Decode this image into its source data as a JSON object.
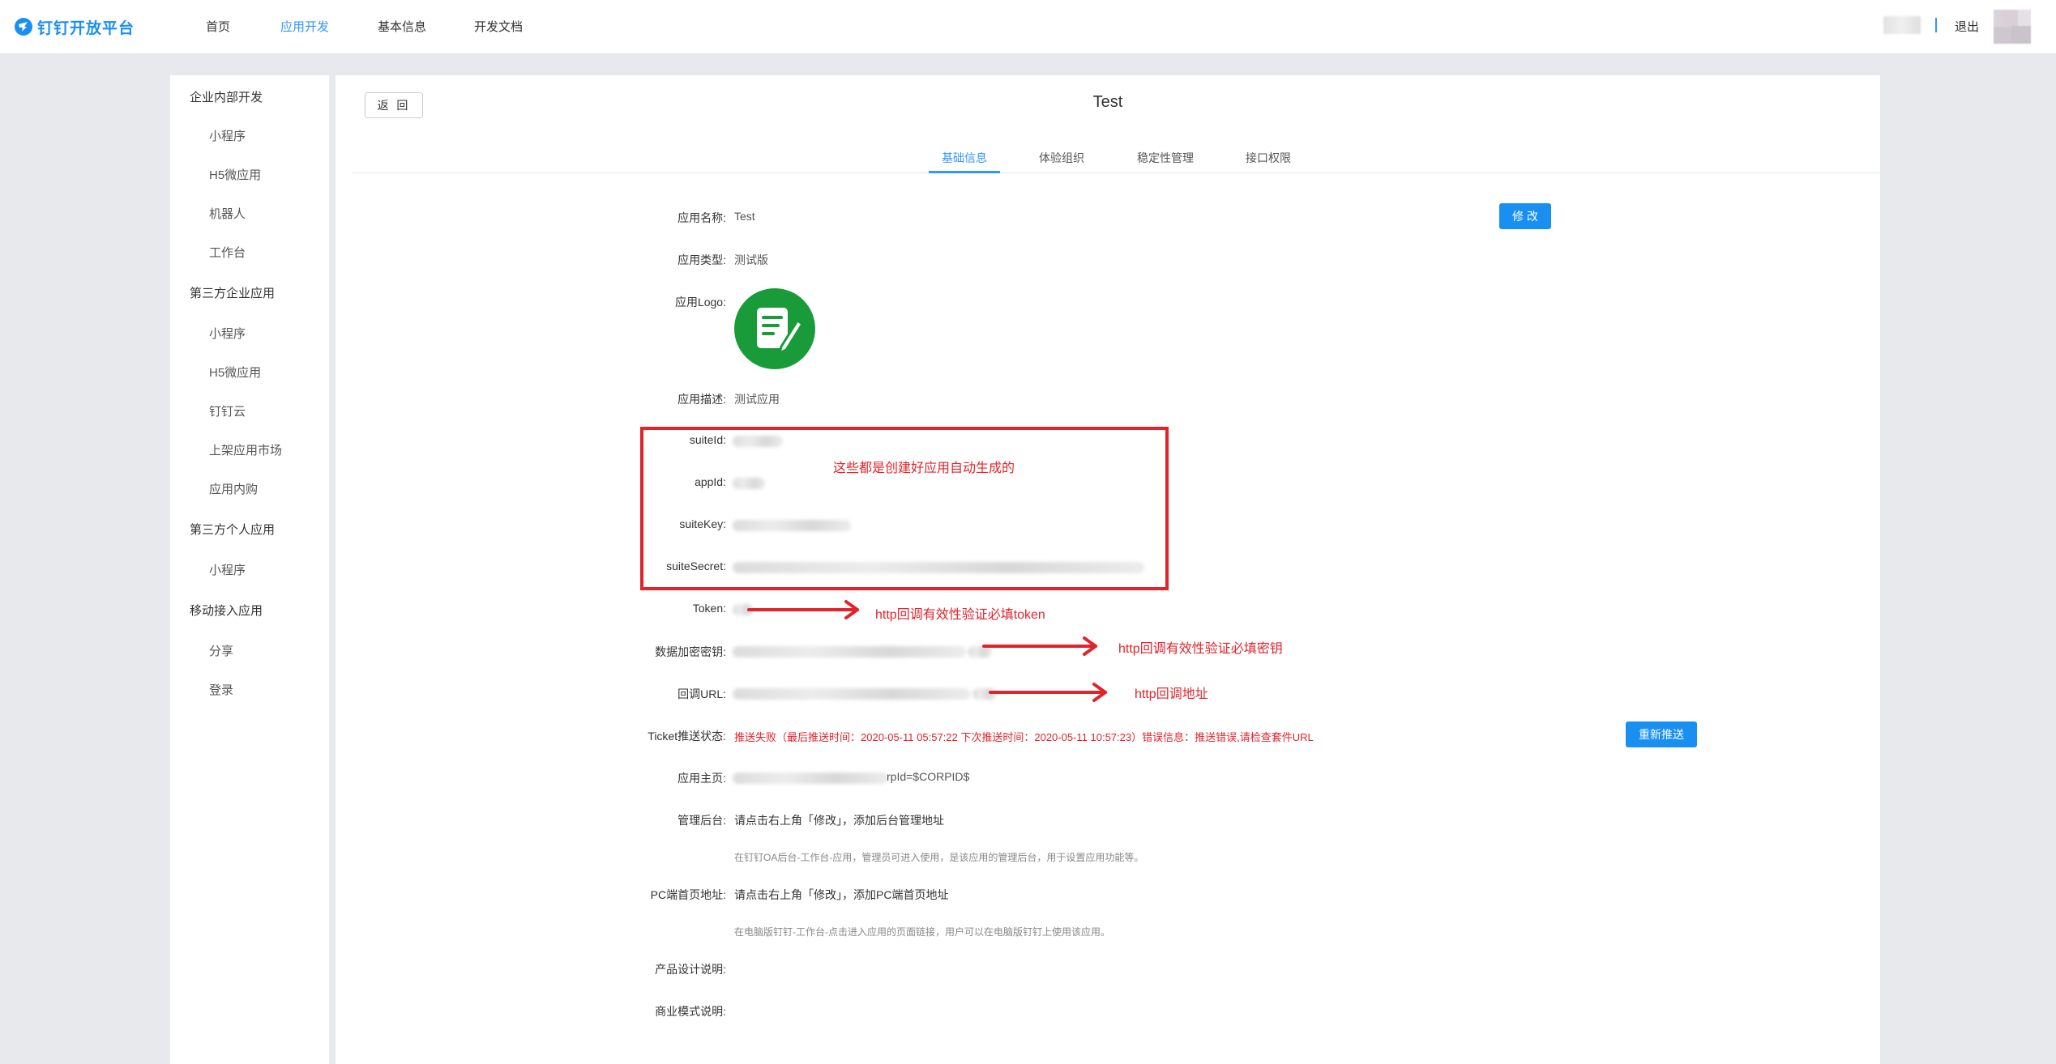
{
  "brand": {
    "name": "钉钉开放平台"
  },
  "nav": [
    "首页",
    "应用开发",
    "基本信息",
    "开发文档"
  ],
  "nav_active_index": 1,
  "user": {
    "logout": "退出"
  },
  "sidebar": {
    "groups": [
      {
        "title": "企业内部开发",
        "items": [
          "小程序",
          "H5微应用",
          "机器人",
          "工作台"
        ]
      },
      {
        "title": "第三方企业应用",
        "items": [
          "小程序",
          "H5微应用",
          "钉钉云",
          "上架应用市场",
          "应用内购"
        ]
      },
      {
        "title": "第三方个人应用",
        "items": [
          "小程序"
        ]
      },
      {
        "title": "移动接入应用",
        "items": [
          "分享",
          "登录"
        ]
      }
    ]
  },
  "main": {
    "back_label": "返 回",
    "title": "Test",
    "tabs": [
      "基础信息",
      "体验组织",
      "稳定性管理",
      "接口权限"
    ],
    "active_tab_index": 0,
    "edit_label": "修 改",
    "fields": {
      "app_name": {
        "label": "应用名称:",
        "value": "Test"
      },
      "app_type": {
        "label": "应用类型:",
        "value": "测试版"
      },
      "app_logo": {
        "label": "应用Logo:"
      },
      "app_desc": {
        "label": "应用描述:",
        "value": "测试应用"
      },
      "suite_id": {
        "label": "suiteId:"
      },
      "app_id": {
        "label": "appId:"
      },
      "suite_key": {
        "label": "suiteKey:"
      },
      "suite_secret": {
        "label": "suiteSecret:"
      },
      "token": {
        "label": "Token:"
      },
      "aes_key": {
        "label": "数据加密密钥:"
      },
      "callback_url": {
        "label": "回调URL:"
      },
      "ticket_status": {
        "label": "Ticket推送状态:",
        "value": "推送失败（最后推送时间：2020-05-11 05:57:22 下次推送时间：2020-05-11 10:57:23）错误信息：推送错误,请检查套件URL",
        "button": "重新推送"
      },
      "homepage": {
        "label": "应用主页:",
        "value_suffix": "rpId=$CORPID$"
      },
      "admin": {
        "label": "管理后台:",
        "value": "请点击右上角「修改」，添加后台管理地址",
        "hint": "在钉钉OA后台-工作台-应用，管理员可进入使用，是该应用的管理后台，用于设置应用功能等。"
      },
      "pc_home": {
        "label": "PC端首页地址:",
        "value": "请点击右上角「修改」，添加PC端首页地址",
        "hint": "在电脑版钉钉-工作台-点击进入应用的页面链接，用户可以在电脑版钉钉上使用该应用。"
      },
      "product_design": {
        "label": "产品设计说明:"
      },
      "business_model": {
        "label": "商业模式说明:"
      }
    }
  },
  "annotations": {
    "box_note": "这些都是创建好应用自动生成的",
    "token_note": "http回调有效性验证必填token",
    "key_note": "http回调有效性验证必填密钥",
    "url_note": "http回调地址"
  },
  "colors": {
    "accent": "#1a8ff2",
    "annotation": "#e0242a",
    "logo_green": "#1a9b3a"
  },
  "icons": {
    "brand": "dingtalk-logo-icon",
    "app_logo": "notepad-pencil-icon",
    "arrow": "red-arrow-icon"
  }
}
